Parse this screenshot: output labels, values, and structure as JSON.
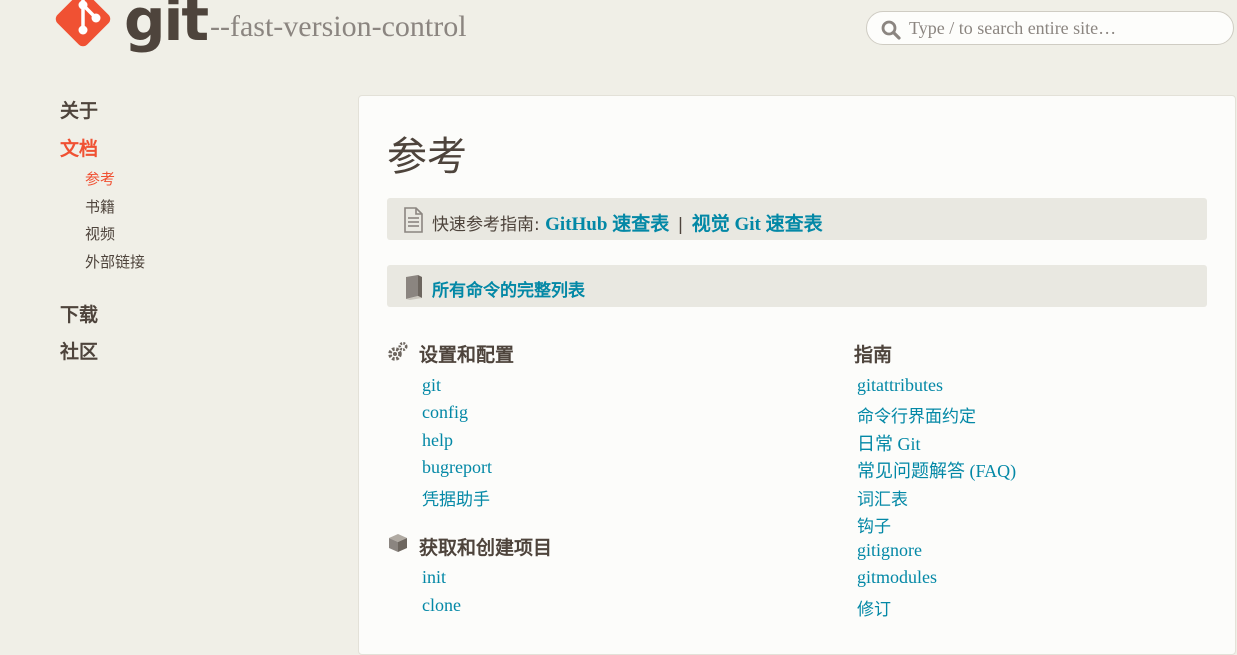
{
  "header": {
    "logo_text": "git",
    "tagline": "--fast-version-control",
    "search_placeholder": "Type / to search entire site…"
  },
  "sidebar": {
    "about": "关于",
    "docs": "文档",
    "docs_sub": [
      "参考",
      "书籍",
      "视频",
      "外部链接"
    ],
    "downloads": "下载",
    "community": "社区"
  },
  "main": {
    "title": "参考",
    "quick_ref": {
      "prefix": "快速参考指南:",
      "link1": "GitHub 速查表",
      "separator": "|",
      "link2": "视觉 Git 速查表"
    },
    "full_list": "所有命令的完整列表",
    "sections_left": [
      {
        "heading": "设置和配置",
        "icon": "gears-icon",
        "items": [
          "git",
          "config",
          "help",
          "bugreport",
          "凭据助手"
        ]
      },
      {
        "heading": "获取和创建项目",
        "icon": "box-icon",
        "items": [
          "init",
          "clone"
        ]
      }
    ],
    "sections_right": [
      {
        "heading": "指南",
        "items": [
          "gitattributes",
          "命令行界面约定",
          "日常 Git",
          "常见问题解答 (FAQ)",
          "词汇表",
          "钩子",
          "gitignore",
          "gitmodules",
          "修订"
        ]
      }
    ]
  },
  "colors": {
    "background": "#f0efe7",
    "accent": "#f05133",
    "link": "#0388a6",
    "text": "#4e443c"
  }
}
